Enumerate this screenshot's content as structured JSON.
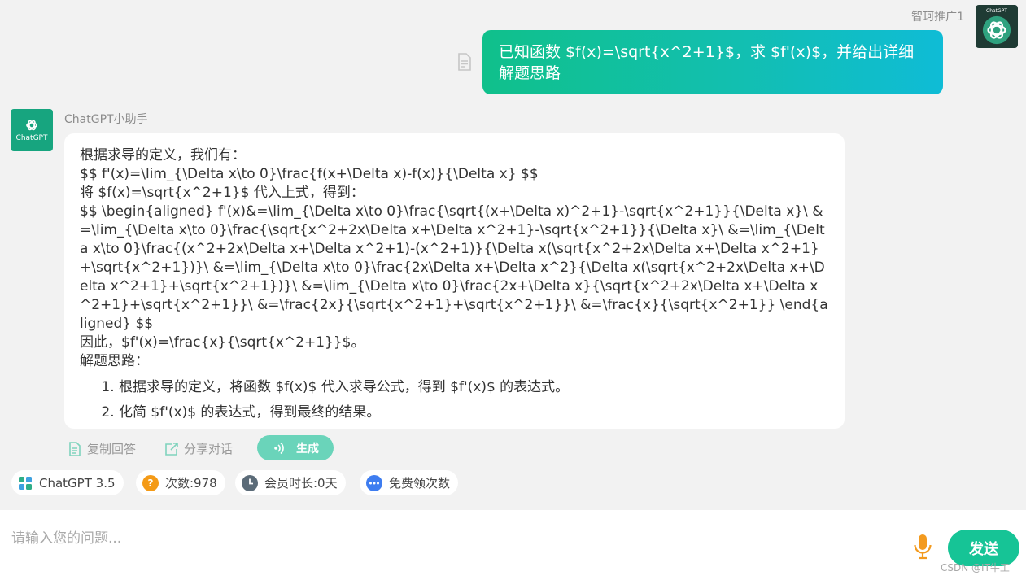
{
  "user": {
    "name": "智珂推广1",
    "avatar_label": "ChatGPT",
    "message": "已知函数 $f(x)=\\sqrt{x^2+1}$，求 $f'(x)$，并给出详细解题思路"
  },
  "assistant": {
    "name": "ChatGPT小助手",
    "avatar_label": "ChatGPT",
    "paragraphs": [
      "根据求导的定义，我们有：",
      "$$ f'(x)=\\lim_{\\Delta x\\to 0}\\frac{f(x+\\Delta x)-f(x)}{\\Delta x} $$",
      "将 $f(x)=\\sqrt{x^2+1}$ 代入上式，得到：",
      "$$ \\begin{aligned} f'(x)&=\\lim_{\\Delta x\\to 0}\\frac{\\sqrt{(x+\\Delta x)^2+1}-\\sqrt{x^2+1}}{\\Delta x}\\ &=\\lim_{\\Delta x\\to 0}\\frac{\\sqrt{x^2+2x\\Delta x+\\Delta x^2+1}-\\sqrt{x^2+1}}{\\Delta x}\\ &=\\lim_{\\Delta x\\to 0}\\frac{(x^2+2x\\Delta x+\\Delta x^2+1)-(x^2+1)}{\\Delta x(\\sqrt{x^2+2x\\Delta x+\\Delta x^2+1}+\\sqrt{x^2+1})}\\ &=\\lim_{\\Delta x\\to 0}\\frac{2x\\Delta x+\\Delta x^2}{\\Delta x(\\sqrt{x^2+2x\\Delta x+\\Delta x^2+1}+\\sqrt{x^2+1})}\\ &=\\lim_{\\Delta x\\to 0}\\frac{2x+\\Delta x}{\\sqrt{x^2+2x\\Delta x+\\Delta x^2+1}+\\sqrt{x^2+1}}\\ &=\\frac{2x}{\\sqrt{x^2+1}+\\sqrt{x^2+1}}\\ &=\\frac{x}{\\sqrt{x^2+1}} \\end{aligned} $$",
      "因此，$f'(x)=\\frac{x}{\\sqrt{x^2+1}}$。",
      "解题思路："
    ],
    "steps": [
      "根据求导的定义，将函数 $f(x)$ 代入求导公式，得到 $f'(x)$ 的表达式。",
      "化简 $f'(x)$ 的表达式，得到最终的结果。"
    ]
  },
  "actions": {
    "copy": "复制回答",
    "share": "分享对话",
    "generate": "生成"
  },
  "chips": {
    "model": "ChatGPT 3.5",
    "count": "次数:978",
    "member": "会员时长:0天",
    "free": "免费领次数"
  },
  "input": {
    "placeholder": "请输入您的问题...",
    "send": "发送"
  },
  "watermark": "CSDN @IT牛工",
  "colors": {
    "accent": "#16c496",
    "gradient_start": "#10c08b",
    "gradient_end": "#0fbcd6"
  }
}
